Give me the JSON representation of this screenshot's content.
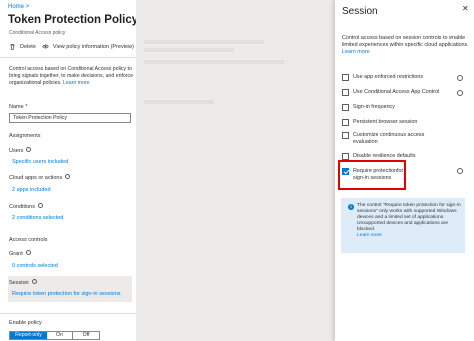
{
  "breadcrumb": "Home >",
  "page_title": "Token Protection Policy",
  "subtitle": "Conditional Access policy",
  "toolbar": {
    "delete_label": "Delete",
    "view_info_label": "View policy information (Preview)"
  },
  "description": "Control access based on Conditional Access policy to bring signals together, to make decisions, and enforce organizational policies.",
  "learn_more": "Learn more",
  "name": {
    "label": "Name *",
    "value": "Token Protection Policy"
  },
  "assignments": {
    "heading": "Assignments",
    "users_label": "Users",
    "users_value": "Specific users included",
    "cloud_label": "Cloud apps or actions",
    "cloud_value": "2 apps included",
    "conditions_label": "Conditions",
    "conditions_value": "2 conditions selected"
  },
  "access_controls": {
    "heading": "Access controls",
    "grant_label": "Grant",
    "grant_value": "0 controls selected",
    "session_label": "Session",
    "session_value": "Require token protection for sign-in sessions"
  },
  "enable_policy": {
    "label": "Enable policy",
    "options": [
      "Report-only",
      "On",
      "Off"
    ],
    "selected": "Report-only"
  },
  "session_panel": {
    "title": "Session",
    "close_icon": "close-icon",
    "description": "Control access based on session controls to enable limited experiences within specific cloud applications.",
    "learn_more": "Learn more",
    "options": [
      {
        "label": "Use app enforced restrictions",
        "checked": false
      },
      {
        "label": "Use Conditional Access App Control",
        "checked": false
      },
      {
        "label": "Sign-in frequency",
        "checked": false
      },
      {
        "label": "Persistent browser session",
        "checked": false
      },
      {
        "label": "Customize continuous access evaluation",
        "checked": false
      },
      {
        "label": "Disable resilience defaults",
        "checked": false
      },
      {
        "label": "Require protectionfor sign-in sessions",
        "checked": true
      }
    ],
    "info_text": "The control \"Require token protection for sign-in sessions\" only works with supported Windows devices and a limited set of applications. Unsupported devices and applications are blocked.",
    "info_learn_more": "Learn more"
  },
  "colors": {
    "accent": "#0078d4",
    "highlight": "#e00000",
    "info_bg": "#deecf9"
  }
}
